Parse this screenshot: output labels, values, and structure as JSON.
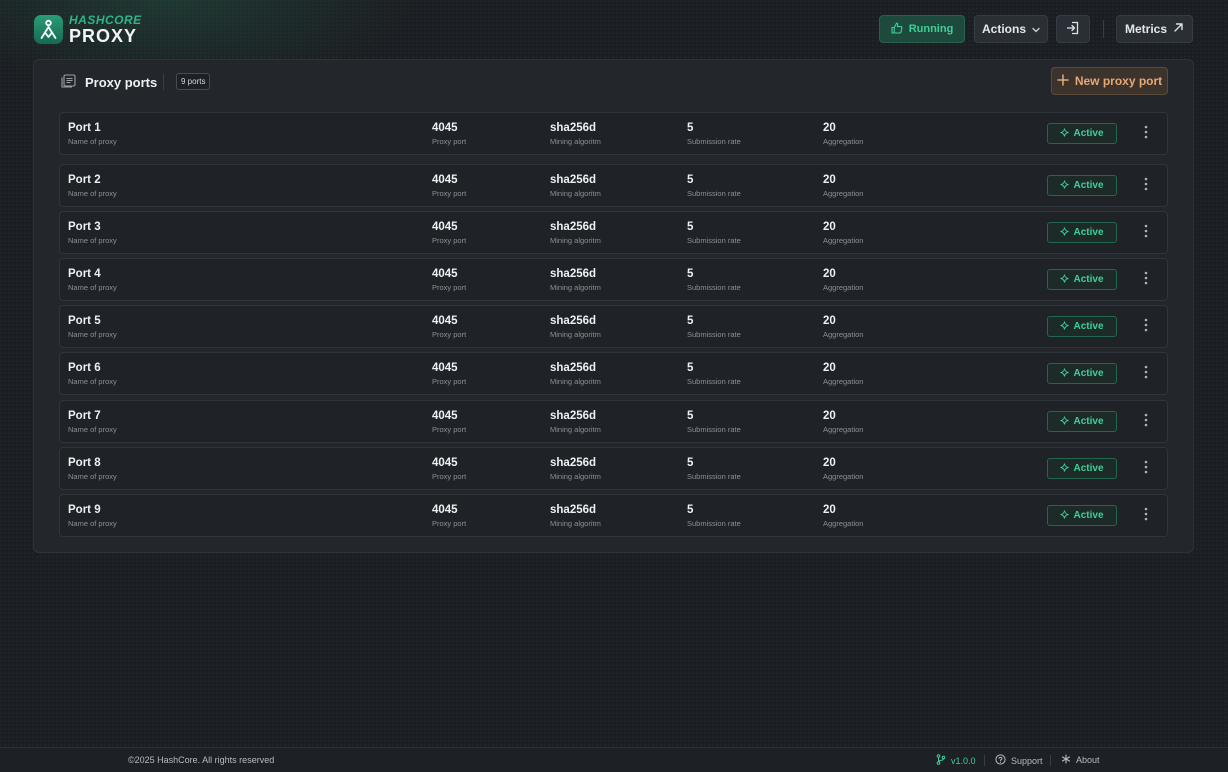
{
  "brand": {
    "top": "HASHCORE",
    "bottom": "PROXY"
  },
  "header": {
    "running_label": "Running",
    "actions_label": "Actions",
    "metrics_label": "Metrics"
  },
  "panel": {
    "title": "Proxy ports",
    "count_badge": "9 ports",
    "new_button": "New proxy port"
  },
  "columns": {
    "name": "Name of proxy",
    "port": "Proxy port",
    "algorithm": "Mining algoritm",
    "rate": "Submission rate",
    "aggregation": "Aggregation"
  },
  "rows": [
    {
      "name": "Port 1",
      "port": "4045",
      "algorithm": "sha256d",
      "rate": "5",
      "aggregation": "20",
      "status": "Active"
    },
    {
      "name": "Port 2",
      "port": "4045",
      "algorithm": "sha256d",
      "rate": "5",
      "aggregation": "20",
      "status": "Active"
    },
    {
      "name": "Port 3",
      "port": "4045",
      "algorithm": "sha256d",
      "rate": "5",
      "aggregation": "20",
      "status": "Active"
    },
    {
      "name": "Port 4",
      "port": "4045",
      "algorithm": "sha256d",
      "rate": "5",
      "aggregation": "20",
      "status": "Active"
    },
    {
      "name": "Port 5",
      "port": "4045",
      "algorithm": "sha256d",
      "rate": "5",
      "aggregation": "20",
      "status": "Active"
    },
    {
      "name": "Port 6",
      "port": "4045",
      "algorithm": "sha256d",
      "rate": "5",
      "aggregation": "20",
      "status": "Active"
    },
    {
      "name": "Port 7",
      "port": "4045",
      "algorithm": "sha256d",
      "rate": "5",
      "aggregation": "20",
      "status": "Active"
    },
    {
      "name": "Port 8",
      "port": "4045",
      "algorithm": "sha256d",
      "rate": "5",
      "aggregation": "20",
      "status": "Active"
    },
    {
      "name": "Port 9",
      "port": "4045",
      "algorithm": "sha256d",
      "rate": "5",
      "aggregation": "20",
      "status": "Active"
    }
  ],
  "footer": {
    "copyright": "©2025 HashCore. All rights reserved",
    "version": "v1.0.0",
    "support": "Support",
    "about": "About"
  },
  "colors": {
    "accent_green": "#3fcf9b",
    "accent_orange": "#e5a877",
    "background": "#1b1e22"
  },
  "icons": {
    "logo": "hashcore-logo-icon",
    "running": "thumbs-up-icon",
    "actions": "chevron-down-icon",
    "exit": "sign-in-icon",
    "metrics": "arrow-up-right-icon",
    "panel": "list-panel-icon",
    "new": "plus-icon",
    "status": "sparkle-icon",
    "more": "more-vertical-icon",
    "version": "git-branch-icon",
    "support": "help-circle-icon",
    "about": "asterisk-icon"
  }
}
